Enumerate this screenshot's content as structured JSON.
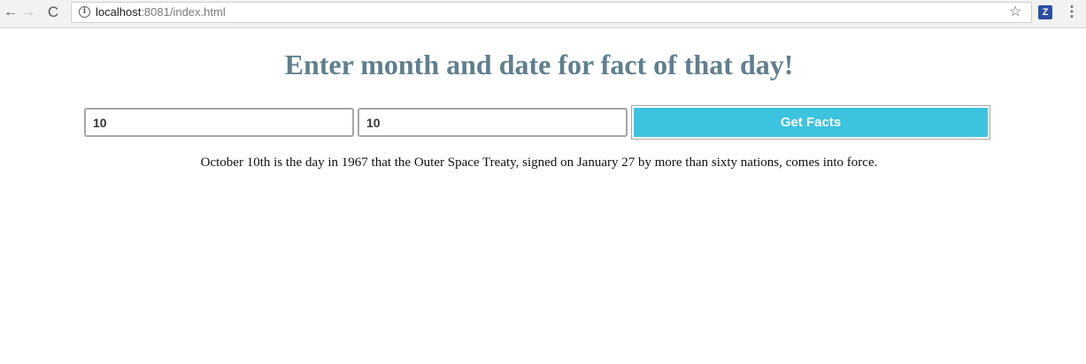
{
  "browser": {
    "back_icon": "arrow-left-icon",
    "forward_icon": "arrow-right-icon",
    "reload_icon": "reload-icon",
    "info_icon": "info-icon",
    "url_host": "localhost",
    "url_rest": ":8081/index.html",
    "star_icon": "star-icon",
    "extension_label": "Z",
    "menu_icon": "kebab-menu-icon"
  },
  "page": {
    "title": "Enter month and date for fact of that day!",
    "month_value": "10",
    "day_value": "10",
    "button_label": "Get Facts",
    "fact": "October 10th is the day in 1967 that the Outer Space Treaty, signed on January 27 by more than sixty nations, comes into force.",
    "colors": {
      "title": "#5f7f8e",
      "button": "#3bc3df",
      "button_text": "#ffffff"
    }
  }
}
